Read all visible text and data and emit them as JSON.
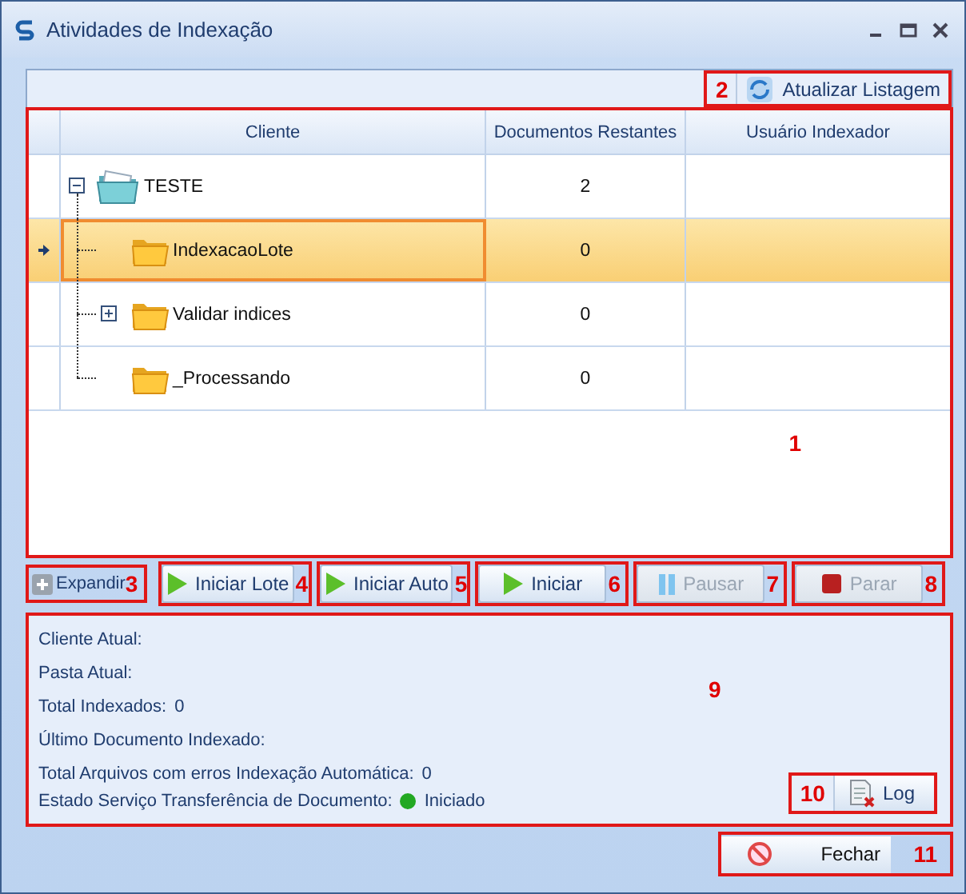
{
  "window": {
    "title": "Atividades de Indexação"
  },
  "toolbar": {
    "refresh_button": {
      "label": "Atualizar Listagem",
      "callout": "2"
    }
  },
  "grid": {
    "callout": "1",
    "columns": [
      "Cliente",
      "Documentos Restantes",
      "Usuário Indexador"
    ],
    "rows": [
      {
        "name": "TESTE",
        "remaining": "2",
        "kind": "root",
        "expanded": true,
        "selected": false,
        "children": [
          {
            "name": "IndexacaoLote",
            "remaining": "0",
            "kind": "folder",
            "selected": true
          },
          {
            "name": "Validar indices",
            "remaining": "0",
            "kind": "folder",
            "expanded": false,
            "selected": false
          },
          {
            "name": "_Processando",
            "remaining": "0",
            "kind": "folder",
            "selected": false
          }
        ]
      }
    ]
  },
  "expand_button": {
    "label": "Expandir",
    "callout": "3"
  },
  "actions": [
    {
      "label": "Iniciar Lote",
      "kind": "play",
      "disabled": false,
      "callout": "4"
    },
    {
      "label": "Iniciar Auto",
      "kind": "play",
      "disabled": false,
      "callout": "5"
    },
    {
      "label": "Iniciar",
      "kind": "play",
      "disabled": false,
      "callout": "6"
    },
    {
      "label": "Pausar",
      "kind": "pause",
      "disabled": true,
      "callout": "7"
    },
    {
      "label": "Parar",
      "kind": "stop",
      "disabled": true,
      "callout": "8"
    }
  ],
  "status": {
    "callout": "9",
    "fields": [
      {
        "label": "Cliente Atual:"
      },
      {
        "label": "Pasta Atual:"
      },
      {
        "label": "Total Indexados:",
        "value": "0"
      },
      {
        "label": "Último Documento Indexado:"
      },
      {
        "label": "Total Arquivos com erros Indexação Automática:",
        "value": "0"
      },
      {
        "label": "Estado Serviço Transferência de Documento:",
        "value": "Iniciado",
        "color": "#22a822"
      }
    ],
    "log_button": {
      "label": "Log",
      "callout": "10"
    }
  },
  "close_button": {
    "label": "Fechar",
    "callout": "11"
  }
}
